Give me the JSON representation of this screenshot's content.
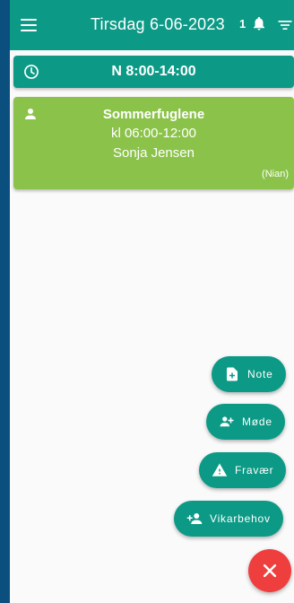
{
  "header": {
    "title": "Tirsdag 6-06-2023",
    "notification_count": "1"
  },
  "shift": {
    "label": "N 8:00-14:00"
  },
  "booking": {
    "group": "Sommerfuglene",
    "time": "kl 06:00-12:00",
    "person": "Sonja Jensen",
    "source": "(Nian)"
  },
  "fab_menu": {
    "note_label": "Note",
    "meeting_label": "Møde",
    "absence_label": "Fravær",
    "substitute_label": "Vikarbehov"
  },
  "colors": {
    "primary": "#0c9a86",
    "card_green": "#8bc34a",
    "close_red": "#ef3e3e",
    "outer_frame": "#0b4f7e"
  }
}
